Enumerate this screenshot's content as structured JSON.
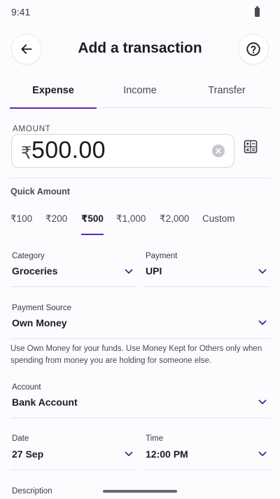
{
  "status_bar": {
    "time": "9:41"
  },
  "header": {
    "title": "Add a transaction"
  },
  "tabs": [
    {
      "label": "Expense",
      "active": true
    },
    {
      "label": "Income",
      "active": false
    },
    {
      "label": "Transfer",
      "active": false
    }
  ],
  "amount": {
    "label": "AMOUNT",
    "currency": "₹",
    "value": "500.00"
  },
  "quick_amount": {
    "label": "Quick Amount",
    "options": [
      "₹100",
      "₹200",
      "₹500",
      "₹1,000",
      "₹2,000",
      "Custom"
    ],
    "selected": "₹500"
  },
  "category": {
    "label": "Category",
    "value": "Groceries"
  },
  "payment": {
    "label": "Payment",
    "value": "UPI"
  },
  "payment_source": {
    "label": "Payment Source",
    "value": "Own Money",
    "help": "Use Own Money for your funds. Use Money Kept for Others only when spending from money you are holding for someone else."
  },
  "account": {
    "label": "Account",
    "value": "Bank Account"
  },
  "date": {
    "label": "Date",
    "value": "27 Sep"
  },
  "time": {
    "label": "Time",
    "value": "12:00 PM"
  },
  "description": {
    "label": "Description"
  },
  "colors": {
    "accent": "#5b2bb8",
    "background": "#fcfbfe",
    "chevron": "#3d2a8c"
  }
}
